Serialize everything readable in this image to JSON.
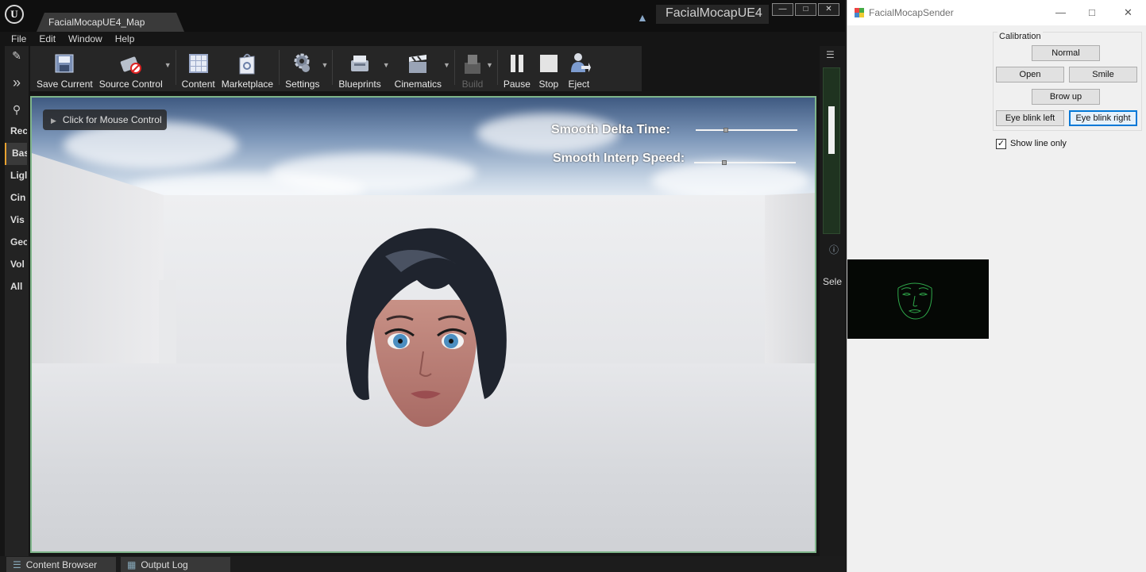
{
  "editor": {
    "tab_title": "FacialMocapUE4_Map",
    "project_name": "FacialMocapUE4",
    "menu": [
      "File",
      "Edit",
      "Window",
      "Help"
    ],
    "toolbar": [
      {
        "label": "Save Current",
        "icon": "save-icon"
      },
      {
        "label": "Source Control",
        "icon": "source-control-icon"
      },
      {
        "label": "Content",
        "icon": "content-icon"
      },
      {
        "label": "Marketplace",
        "icon": "marketplace-icon"
      },
      {
        "label": "Settings",
        "icon": "settings-icon"
      },
      {
        "label": "Blueprints",
        "icon": "blueprints-icon"
      },
      {
        "label": "Cinematics",
        "icon": "cinematics-icon"
      },
      {
        "label": "Build",
        "icon": "build-icon"
      },
      {
        "label": "Pause",
        "icon": "pause-icon"
      },
      {
        "label": "Stop",
        "icon": "stop-icon"
      },
      {
        "label": "Eject",
        "icon": "eject-icon"
      }
    ],
    "place_panel": [
      "Rec",
      "Bas",
      "Ligl",
      "Cin",
      "Vis",
      "Geo",
      "Vol",
      "All"
    ],
    "place_panel_active": "Bas",
    "viewport": {
      "mouse_control": "Click for Mouse Control",
      "smooth_delta_label": "Smooth Delta Time:",
      "smooth_delta_value": 0.3,
      "smooth_interp_label": "Smooth Interp Speed:",
      "smooth_interp_value": 0.3
    },
    "right_panel_label": "Sele",
    "bottom_tabs": [
      "Content Browser",
      "Output Log"
    ]
  },
  "sender": {
    "window_title": "FacialMocapSender",
    "group_label": "Calibration",
    "buttons": {
      "normal": "Normal",
      "open": "Open",
      "smile": "Smile",
      "brow_up": "Brow up",
      "eye_blink_left": "Eye blink left",
      "eye_blink_right": "Eye blink right"
    },
    "show_line_only_label": "Show line only",
    "show_line_only_checked": true
  },
  "colors": {
    "viewport_border": "#7fb58a",
    "focus_blue": "#0078d7",
    "face_lines": "#2fa84a"
  }
}
